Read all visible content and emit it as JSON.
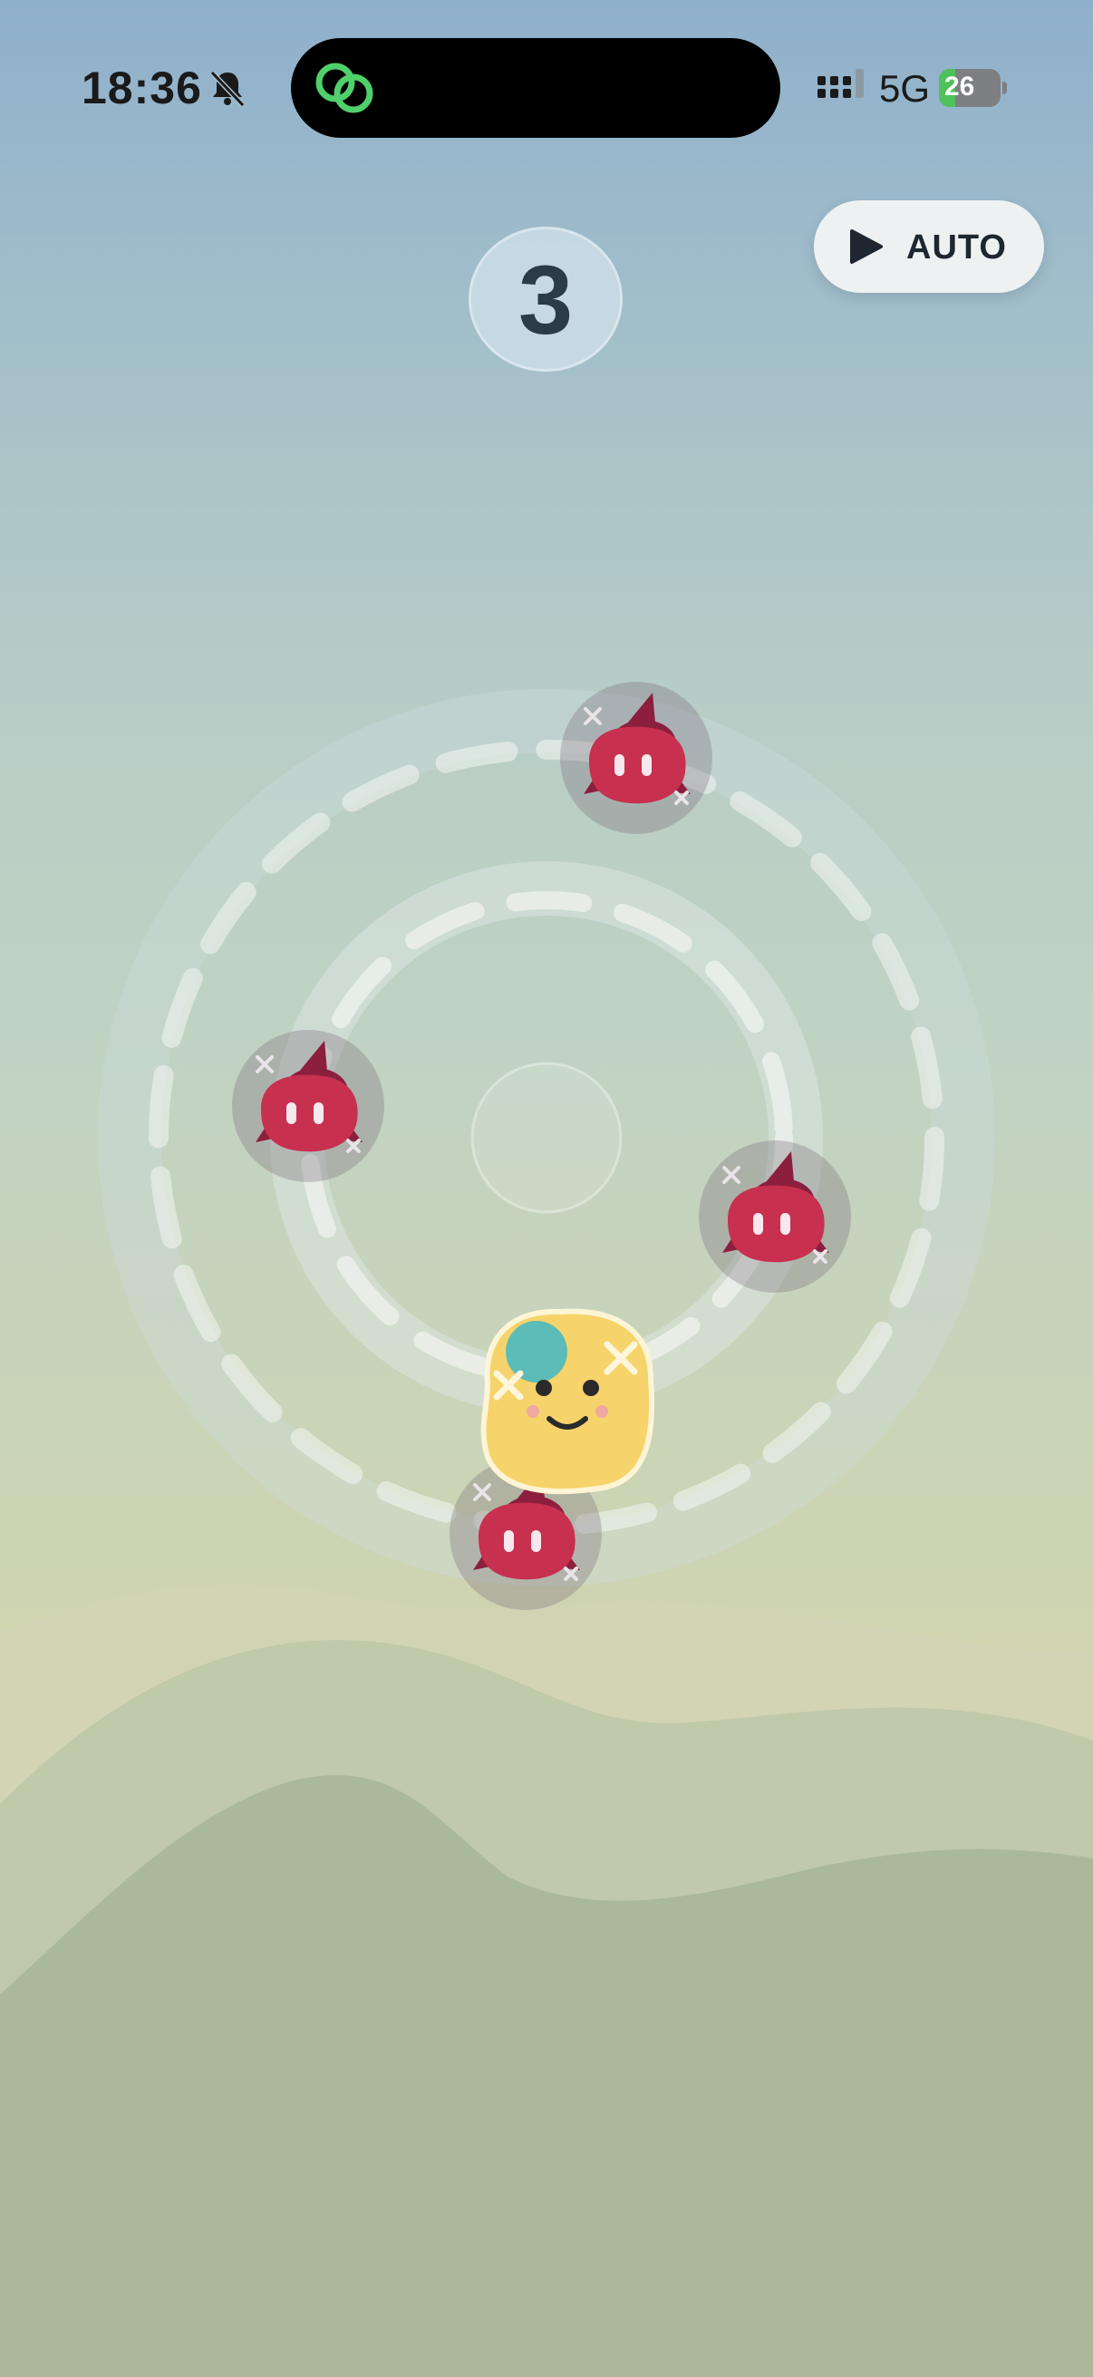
{
  "status_bar": {
    "time": "18:36",
    "network": "5G",
    "battery": "26",
    "battery_level_percent": 26,
    "icons": [
      "bell-slash-icon",
      "signal-icon",
      "battery-charging-icon"
    ]
  },
  "dynamic_island": {
    "app_icon": "linked-circles-icon"
  },
  "game": {
    "score": "3",
    "auto_button_label": "AUTO",
    "auto_button_icon": "play-icon",
    "orbits": [
      "inner-orbit",
      "outer-orbit"
    ],
    "player": "yellow-blob-player",
    "enemies": [
      "red-spiky-enemy",
      "red-spiky-enemy",
      "red-spiky-enemy",
      "red-spiky-enemy"
    ]
  },
  "colors": {
    "player": "#f6d46b",
    "enemy": "#c7304f",
    "teal_spot": "#5bbcb8",
    "score_text": "#2c3b48"
  }
}
